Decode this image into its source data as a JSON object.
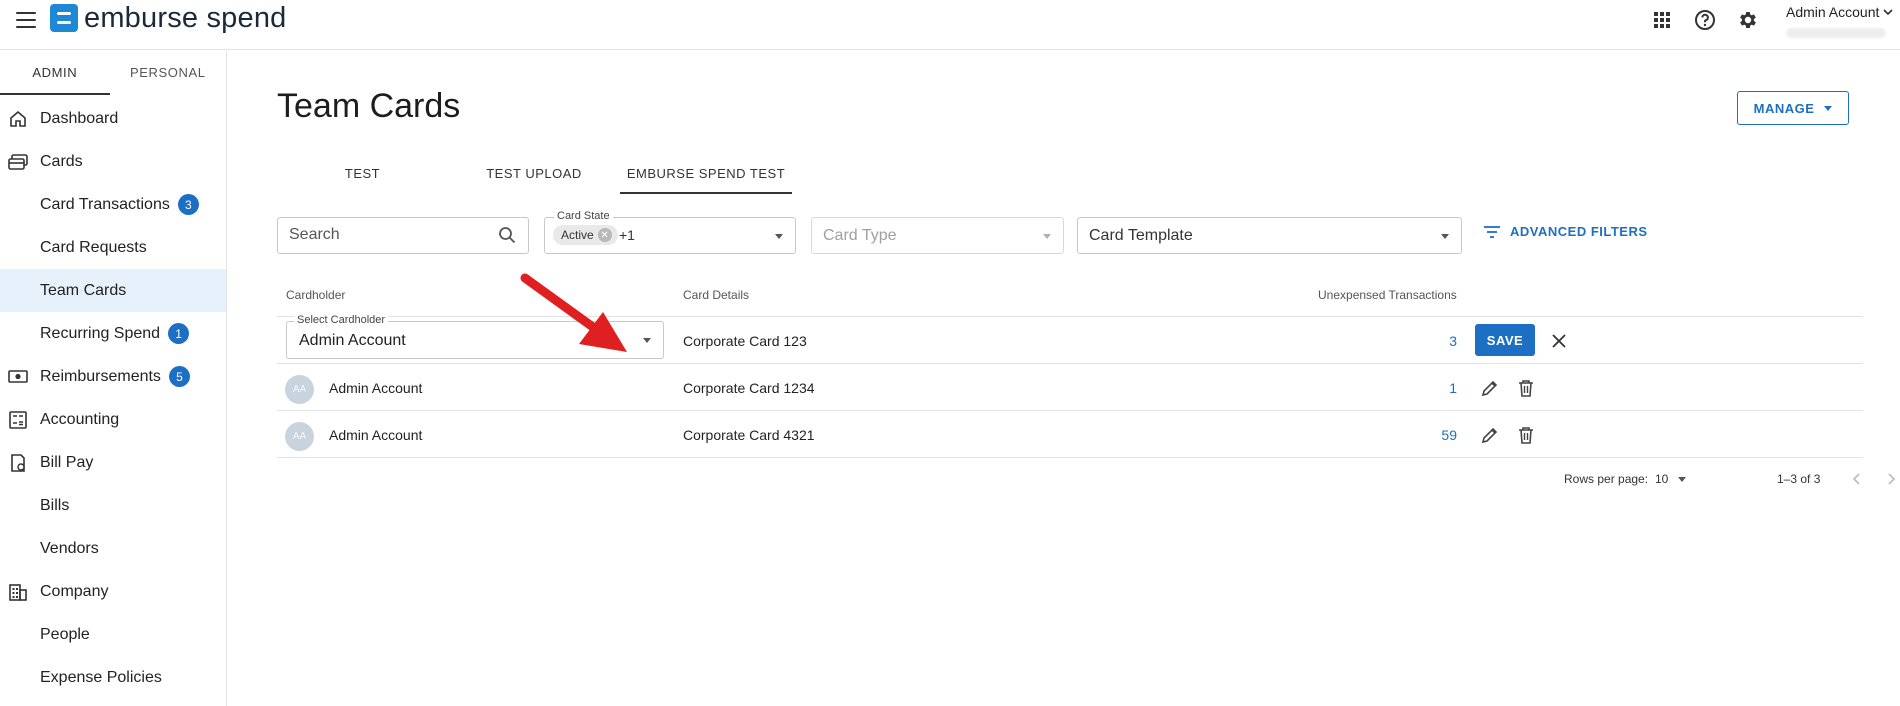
{
  "app": {
    "logo_text": "emburse spend",
    "account_name": "Admin Account"
  },
  "top_icons": [
    "apps-grid-icon",
    "help-icon",
    "gear-icon"
  ],
  "sidebar": {
    "tabs": [
      "ADMIN",
      "PERSONAL"
    ],
    "items": [
      {
        "label": "Dashboard",
        "icon": "home-icon"
      },
      {
        "label": "Cards",
        "icon": "cards-icon"
      },
      {
        "label": "Card Transactions",
        "badge": "3"
      },
      {
        "label": "Card Requests"
      },
      {
        "label": "Team Cards",
        "active": true
      },
      {
        "label": "Recurring Spend",
        "badge": "1"
      },
      {
        "label": "Reimbursements",
        "icon": "money-icon",
        "badge": "5"
      },
      {
        "label": "Accounting",
        "icon": "accounting-icon"
      },
      {
        "label": "Bill Pay",
        "icon": "bill-icon"
      },
      {
        "label": "Bills"
      },
      {
        "label": "Vendors"
      },
      {
        "label": "Company",
        "icon": "building-icon"
      },
      {
        "label": "People"
      },
      {
        "label": "Expense Policies"
      }
    ]
  },
  "main": {
    "title": "Team Cards",
    "manage_label": "MANAGE",
    "tabs": [
      "TEST",
      "TEST UPLOAD",
      "EMBURSE SPEND TEST"
    ],
    "filters": {
      "search_placeholder": "Search",
      "card_state_label": "Card State",
      "card_state_chip": "Active",
      "card_state_more": "+1",
      "card_type_placeholder": "Card Type",
      "card_template_value": "Card Template",
      "advanced_filters_label": "ADVANCED FILTERS"
    },
    "table": {
      "headers": {
        "cardholder": "Cardholder",
        "card_details": "Card Details",
        "unexpensed": "Unexpensed Transactions"
      },
      "edit_row": {
        "select_label": "Select Cardholder",
        "select_value": "Admin Account",
        "card": "Corporate Card 123",
        "count": "3",
        "save_label": "SAVE"
      },
      "rows": [
        {
          "initials": "AA",
          "name": "Admin Account",
          "card": "Corporate Card 1234",
          "count": "1"
        },
        {
          "initials": "AA",
          "name": "Admin Account",
          "card": "Corporate Card 4321",
          "count": "59"
        }
      ]
    },
    "pagination": {
      "rows_per_page_label": "Rows per page:",
      "rows_per_page": "10",
      "range": "1–3 of 3"
    }
  },
  "colors": {
    "accent": "#1d6fc4",
    "active_nav_bg": "#e6f1fb",
    "annotation_arrow": "#e02020"
  }
}
